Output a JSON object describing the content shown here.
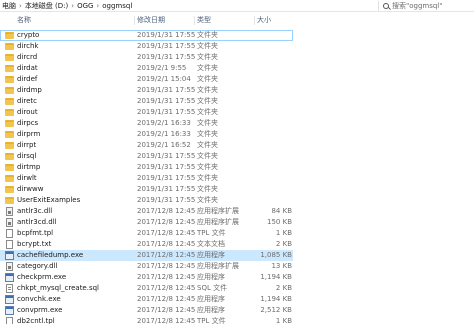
{
  "breadcrumb": [
    "电脑",
    "本地磁盘 (D:)",
    "OGG",
    "oggmsql"
  ],
  "search_placeholder": "搜索\"oggmsql\"",
  "columns": {
    "name": "名称",
    "date": "修改日期",
    "type": "类型",
    "size": "大小"
  },
  "files": [
    {
      "name": "crypto",
      "date": "2019/1/31 17:55",
      "type": "文件夹",
      "size": "",
      "icon": "folder-icon"
    },
    {
      "name": "dirchk",
      "date": "2019/1/31 17:55",
      "type": "文件夹",
      "size": "",
      "icon": "folder-icon"
    },
    {
      "name": "dircrd",
      "date": "2019/1/31 17:55",
      "type": "文件夹",
      "size": "",
      "icon": "folder-icon"
    },
    {
      "name": "dirdat",
      "date": "2019/2/1 9:55",
      "type": "文件夹",
      "size": "",
      "icon": "folder-icon"
    },
    {
      "name": "dirdef",
      "date": "2019/2/1 15:04",
      "type": "文件夹",
      "size": "",
      "icon": "folder-icon"
    },
    {
      "name": "dirdmp",
      "date": "2019/1/31 17:55",
      "type": "文件夹",
      "size": "",
      "icon": "folder-icon"
    },
    {
      "name": "diretc",
      "date": "2019/1/31 17:55",
      "type": "文件夹",
      "size": "",
      "icon": "folder-icon"
    },
    {
      "name": "dirout",
      "date": "2019/1/31 17:55",
      "type": "文件夹",
      "size": "",
      "icon": "folder-icon"
    },
    {
      "name": "dirpcs",
      "date": "2019/2/1 16:33",
      "type": "文件夹",
      "size": "",
      "icon": "folder-icon"
    },
    {
      "name": "dirprm",
      "date": "2019/2/1 16:33",
      "type": "文件夹",
      "size": "",
      "icon": "folder-icon"
    },
    {
      "name": "dirrpt",
      "date": "2019/2/1 16:52",
      "type": "文件夹",
      "size": "",
      "icon": "folder-icon"
    },
    {
      "name": "dirsql",
      "date": "2019/1/31 17:55",
      "type": "文件夹",
      "size": "",
      "icon": "folder-icon"
    },
    {
      "name": "dirtmp",
      "date": "2019/1/31 17:55",
      "type": "文件夹",
      "size": "",
      "icon": "folder-icon"
    },
    {
      "name": "dirwlt",
      "date": "2019/1/31 17:55",
      "type": "文件夹",
      "size": "",
      "icon": "folder-icon"
    },
    {
      "name": "dirwww",
      "date": "2019/1/31 17:55",
      "type": "文件夹",
      "size": "",
      "icon": "folder-icon"
    },
    {
      "name": "UserExitExamples",
      "date": "2019/1/31 17:55",
      "type": "文件夹",
      "size": "",
      "icon": "folder-icon"
    },
    {
      "name": "antlr3c.dll",
      "date": "2017/12/8 12:45",
      "type": "应用程序扩展",
      "size": "84 KB",
      "icon": "dll-icon"
    },
    {
      "name": "antlr3cd.dll",
      "date": "2017/12/8 12:45",
      "type": "应用程序扩展",
      "size": "150 KB",
      "icon": "dll-icon"
    },
    {
      "name": "bcpfmt.tpl",
      "date": "2017/12/8 12:45",
      "type": "TPL 文件",
      "size": "1 KB",
      "icon": "file-icon"
    },
    {
      "name": "bcrypt.txt",
      "date": "2017/12/8 12:45",
      "type": "文本文档",
      "size": "2 KB",
      "icon": "file-icon"
    },
    {
      "name": "cachefiledump.exe",
      "date": "2017/12/8 12:45",
      "type": "应用程序",
      "size": "1,085 KB",
      "icon": "exe-icon"
    },
    {
      "name": "category.dll",
      "date": "2017/12/8 12:45",
      "type": "应用程序扩展",
      "size": "13 KB",
      "icon": "dll-icon"
    },
    {
      "name": "checkprm.exe",
      "date": "2017/12/8 12:45",
      "type": "应用程序",
      "size": "1,194 KB",
      "icon": "exe-icon"
    },
    {
      "name": "chkpt_mysql_create.sql",
      "date": "2017/12/8 12:45",
      "type": "SQL 文件",
      "size": "2 KB",
      "icon": "sql-icon"
    },
    {
      "name": "convchk.exe",
      "date": "2017/12/8 12:45",
      "type": "应用程序",
      "size": "1,194 KB",
      "icon": "exe-icon"
    },
    {
      "name": "convprm.exe",
      "date": "2017/12/8 12:45",
      "type": "应用程序",
      "size": "2,512 KB",
      "icon": "exe-icon"
    },
    {
      "name": "db2cntl.tpl",
      "date": "2017/12/8 12:45",
      "type": "TPL 文件",
      "size": "1 KB",
      "icon": "file-icon"
    }
  ],
  "selected_row": 0,
  "highlighted_row": 20
}
